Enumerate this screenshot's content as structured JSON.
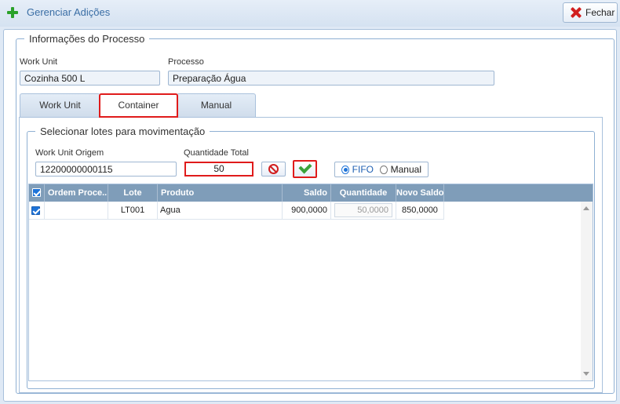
{
  "header": {
    "title": "Gerenciar Adições",
    "close_label": "Fechar"
  },
  "process_info": {
    "legend": "Informações do Processo",
    "work_unit_label": "Work Unit",
    "work_unit_value": "Cozinha 500 L",
    "process_label": "Processo",
    "process_value": "Preparação Água"
  },
  "tabs": [
    {
      "label": "Work Unit",
      "active": false
    },
    {
      "label": "Container",
      "active": true
    },
    {
      "label": "Manual",
      "active": false
    }
  ],
  "lotes": {
    "legend": "Selecionar lotes para movimentação",
    "origin_label": "Work Unit Origem",
    "origin_value": "12200000000115",
    "qty_total_label": "Quantidade Total",
    "qty_total_value": "50",
    "radio_fifo": "FIFO",
    "radio_manual": "Manual",
    "selected_mode": "FIFO"
  },
  "grid": {
    "columns": [
      "Ordem Proce...",
      "Lote",
      "Produto",
      "Saldo",
      "Quantidade",
      "Novo Saldo"
    ],
    "rows": [
      {
        "checked": true,
        "ordem": "",
        "lote": "LT001",
        "produto": "Agua",
        "saldo": "900,0000",
        "quantidade": "50,0000",
        "novo_saldo": "850,0000"
      }
    ]
  },
  "colors": {
    "accent": "#1e73d8",
    "highlight": "#e01b1b",
    "grid_header": "#7f9db9"
  }
}
